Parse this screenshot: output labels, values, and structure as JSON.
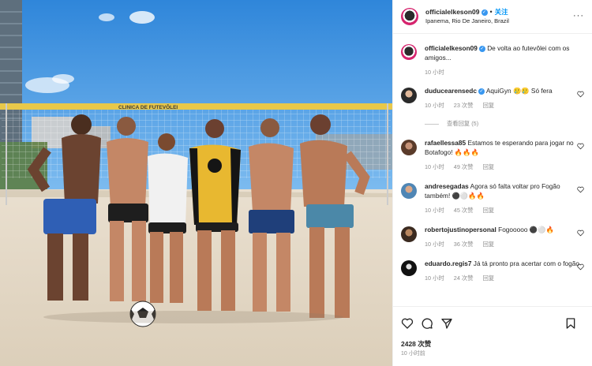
{
  "post": {
    "username": "officialelkeson09",
    "verified_mark": "✓",
    "follow_label": "关注",
    "separator": "•",
    "location": "Ipanema, Rio De Janeiro, Brazil",
    "more_label": "···",
    "caption_text": "De volta ao futevôlei com os amigos...",
    "caption_time": "10 小时",
    "likes": "2428 次赞",
    "timestamp": "10 小时前"
  },
  "photo": {
    "net_banner_text": "CLINICA DE FUTEVÔLEI",
    "colors": {
      "sky": "#3f95e0",
      "sand": "#e7dccb",
      "net_banner": "#e8c84a"
    }
  },
  "comments": [
    {
      "user": "duducearensedc",
      "verified": true,
      "text": "AquiGyn 🥲🥲 Só fera",
      "time": "10 小时",
      "likes": "23 次赞",
      "reply": "回复",
      "view_replies": "查看回复 (5)"
    },
    {
      "user": "rafaellessa85",
      "verified": false,
      "text": "Estamos te esperando para jogar no Botafogo! 🔥🔥🔥",
      "time": "10 小时",
      "likes": "49 次赞",
      "reply": "回复"
    },
    {
      "user": "andresegadas",
      "verified": false,
      "text": "Agora só falta voltar pro Fogão também! ⚫⚪🔥🔥",
      "time": "10 小时",
      "likes": "45 次赞",
      "reply": "回复"
    },
    {
      "user": "robertojustinopersonal",
      "verified": false,
      "text": "Fogooooo ⚫⚪🔥",
      "time": "10 小时",
      "likes": "36 次赞",
      "reply": "回复"
    },
    {
      "user": "eduardo.regis7",
      "verified": false,
      "text": "Já tá pronto pra acertar com o fogão",
      "time": "10 小时",
      "likes": "24 次赞",
      "reply": "回复"
    }
  ],
  "icons": {
    "like": "heart-icon",
    "comment": "comment-icon",
    "share": "share-icon",
    "save": "bookmark-icon"
  }
}
